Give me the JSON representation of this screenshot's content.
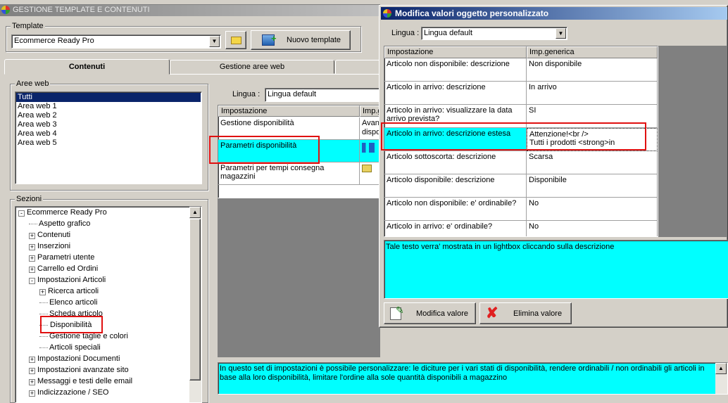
{
  "main_window": {
    "title": "GESTIONE TEMPLATE E CONTENUTI",
    "template_group": "Template",
    "template_value": "Ecommerce Ready Pro",
    "new_template_button": "Nuovo template",
    "tabs": [
      "Contenuti",
      "Gestione aree web"
    ],
    "aree_web_group": "Aree web",
    "aree_web": [
      "Tutti",
      "Area web 1",
      "Area web 2",
      "Area web 3",
      "Area web 4",
      "Area web 5"
    ],
    "sezioni_group": "Sezioni",
    "tree": [
      {
        "label": "Ecommerce Ready Pro",
        "level": 0,
        "expander": "-"
      },
      {
        "label": "Aspetto grafico",
        "level": 1,
        "expander": ""
      },
      {
        "label": "Contenuti",
        "level": 1,
        "expander": "+"
      },
      {
        "label": "Inserzioni",
        "level": 1,
        "expander": "+"
      },
      {
        "label": "Parametri utente",
        "level": 1,
        "expander": "+"
      },
      {
        "label": "Carrello ed Ordini",
        "level": 1,
        "expander": "+"
      },
      {
        "label": "Impostazioni Articoli",
        "level": 1,
        "expander": "-"
      },
      {
        "label": "Ricerca articoli",
        "level": 2,
        "expander": "+"
      },
      {
        "label": "Elenco articoli",
        "level": 2,
        "expander": ""
      },
      {
        "label": "Scheda articolo",
        "level": 2,
        "expander": ""
      },
      {
        "label": "Disponibilità",
        "level": 2,
        "expander": ""
      },
      {
        "label": "Gestione taglie e colori",
        "level": 2,
        "expander": ""
      },
      {
        "label": "Articoli speciali",
        "level": 2,
        "expander": ""
      },
      {
        "label": "Impostazioni Documenti",
        "level": 1,
        "expander": "+"
      },
      {
        "label": "Impostazioni avanzate sito",
        "level": 1,
        "expander": "+"
      },
      {
        "label": "Messaggi e testi delle email",
        "level": 1,
        "expander": "+"
      },
      {
        "label": "Indicizzazione / SEO",
        "level": 1,
        "expander": "+"
      }
    ],
    "lingua_label": "Lingua :",
    "lingua_value": "Lingua default",
    "grid_headers": [
      "Impostazione",
      "Imp.g"
    ],
    "grid_rows": [
      {
        "name": "Gestione disponibilità",
        "value": "Avan\ndispo"
      },
      {
        "name": "Parametri disponibilità",
        "value": ""
      },
      {
        "name": "Parametri per tempi consegna magazzini",
        "value": ""
      }
    ],
    "description": "In questo set di impostazioni è possibile personalizzare: le diciture per i vari stati di disponibilità, rendere ordinabili / non ordinabili gli articoli in base alla loro disponibilità, limitare l'ordine alla sole quantità disponibili a magazzino"
  },
  "dialog": {
    "title": "Modifica valori oggetto personalizzato",
    "lingua_label": "Lingua :",
    "lingua_value": "Lingua default",
    "headers": [
      "Impostazione",
      "Imp.generica"
    ],
    "rows": [
      {
        "name": "Articolo non disponibile: descrizione",
        "value": "Non disponibile"
      },
      {
        "name": "Articolo in arrivo: descrizione",
        "value": "In arrivo"
      },
      {
        "name": "Articolo in arrivo: visualizzare la data arrivo prevista?",
        "value": "SI"
      },
      {
        "name": "Articolo in arrivo: descrizione estesa",
        "value": "Attenzione!<br />\nTutti i prodotti <strong>in"
      },
      {
        "name": "Articolo sottoscorta: descrizione",
        "value": "Scarsa"
      },
      {
        "name": "Articolo disponibile: descrizione",
        "value": "Disponibile"
      },
      {
        "name": "Articolo non disponibile: e' ordinabile?",
        "value": "No"
      },
      {
        "name": "Articolo in arrivo: e' ordinabile?",
        "value": "No"
      }
    ],
    "help_text": "Tale testo verra' mostrata in un lightbox cliccando sulla descrizione",
    "edit_button": "Modifica valore",
    "delete_button": "Elimina valore"
  }
}
